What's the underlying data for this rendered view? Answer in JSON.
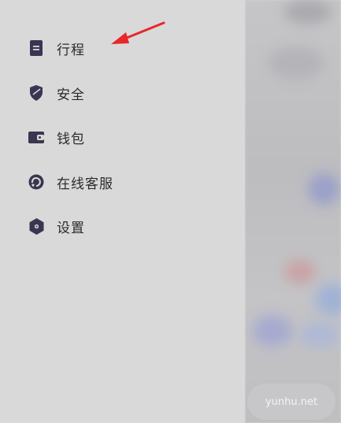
{
  "menu": {
    "items": [
      {
        "label": "行程",
        "icon": "document-icon"
      },
      {
        "label": "安全",
        "icon": "shield-icon"
      },
      {
        "label": "钱包",
        "icon": "wallet-icon"
      },
      {
        "label": "在线客服",
        "icon": "headset-icon"
      },
      {
        "label": "设置",
        "icon": "gear-icon"
      }
    ]
  },
  "watermark": {
    "text": "yunhu.net"
  },
  "colors": {
    "icon": "#3a3550",
    "text": "#2b2b2b",
    "drawer_bg": "#d9d9d9",
    "arrow": "#e8262b"
  }
}
